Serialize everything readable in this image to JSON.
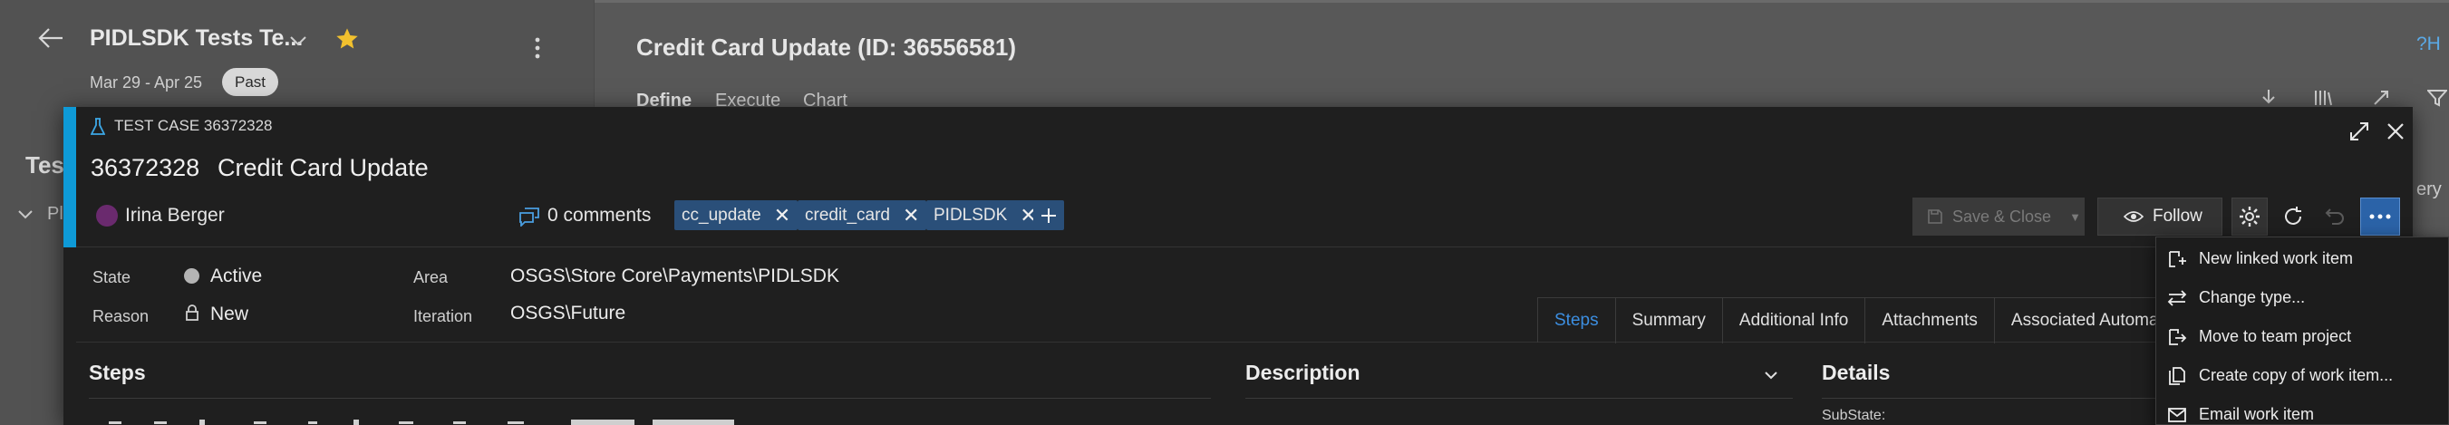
{
  "background": {
    "back_icon": "arrow-left-icon",
    "plan_title": "PIDLSDK Tests Te...",
    "date_range": "Mar 29 - Apr 25",
    "past_badge": "Past",
    "test_partial": "Test",
    "pl_partial": "Pl",
    "suite_title": "Credit Card Update (ID: 36556581)",
    "tabs": [
      "Define",
      "Execute",
      "Chart"
    ],
    "help_partial": "?H",
    "query_partial": "ery"
  },
  "work_item": {
    "type_label": "TEST CASE 36372328",
    "id": "36372328",
    "title": "Credit Card Update",
    "assigned_to": "Irina Berger",
    "comments": "0 comments",
    "tags": [
      "cc_update",
      "credit_card",
      "PIDLSDK"
    ],
    "save_close": "Save & Close",
    "follow": "Follow",
    "fields": {
      "state_label": "State",
      "state_value": "Active",
      "reason_label": "Reason",
      "reason_value": "New",
      "area_label": "Area",
      "area_value": "OSGS\\Store Core\\Payments\\PIDLSDK",
      "iteration_label": "Iteration",
      "iteration_value": "OSGS\\Future"
    },
    "tabs": [
      "Steps",
      "Summary",
      "Additional Info",
      "Attachments",
      "Associated Automation"
    ],
    "sections": {
      "steps": "Steps",
      "description": "Description",
      "details": "Details",
      "substate": "SubState:"
    }
  },
  "menu": {
    "items": [
      {
        "label": "New linked work item",
        "icon": "new-linked-icon"
      },
      {
        "label": "Change type...",
        "icon": "change-type-icon"
      },
      {
        "label": "Move to team project",
        "icon": "move-icon"
      },
      {
        "label": "Create copy of work item...",
        "icon": "copy-icon"
      },
      {
        "label": "Email work item",
        "icon": "mail-icon"
      }
    ]
  },
  "colors": {
    "accent": "#0e9ad7",
    "tag_bg": "#2a4f79",
    "star": "#f2c12e",
    "active_tab": "#3c8ee0"
  }
}
